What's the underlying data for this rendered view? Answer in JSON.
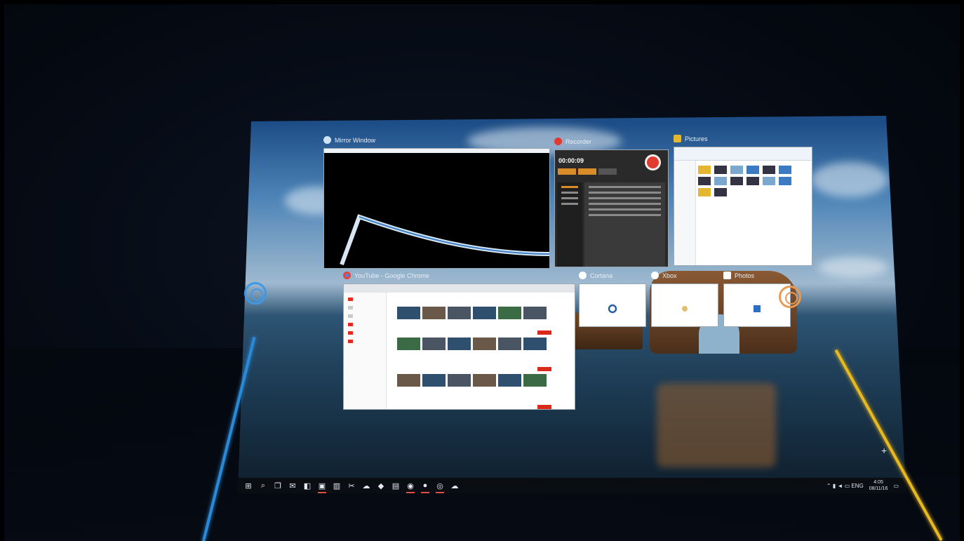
{
  "windows": {
    "vr_view": {
      "title": "Mirror Window",
      "title_color": "#cfe3f5"
    },
    "media_app": {
      "title": "Recorder",
      "time": "00:00:09",
      "accent": "#d98c28",
      "record_color": "#e23a2e"
    },
    "explorer": {
      "title": "Pictures"
    },
    "chrome": {
      "title": "YouTube - Google Chrome"
    },
    "app_a": {
      "title": "Cortana"
    },
    "app_b": {
      "title": "Xbox"
    },
    "app_c": {
      "title": "Photos"
    }
  },
  "handles": {
    "left_color": "#3e9ae6",
    "right_color": "#e89a54"
  },
  "taskbar": {
    "items": [
      {
        "icon": "windows-start-icon",
        "glyph": "⊞",
        "open": false
      },
      {
        "icon": "search-icon",
        "glyph": "⌕",
        "open": false
      },
      {
        "icon": "task-view-icon",
        "glyph": "❐",
        "open": false
      },
      {
        "icon": "mail-icon",
        "glyph": "✉",
        "open": false
      },
      {
        "icon": "store-icon",
        "glyph": "◧",
        "open": false
      },
      {
        "icon": "file-explorer-icon",
        "glyph": "▣",
        "open": true
      },
      {
        "icon": "trash-icon",
        "glyph": "▥",
        "open": false
      },
      {
        "icon": "snip-icon",
        "glyph": "✂",
        "open": false
      },
      {
        "icon": "weather-icon",
        "glyph": "☁",
        "open": false
      },
      {
        "icon": "vr-icon",
        "glyph": "◆",
        "open": false
      },
      {
        "icon": "media-player-icon",
        "glyph": "▤",
        "open": false
      },
      {
        "icon": "steam-icon",
        "glyph": "◉",
        "open": true
      },
      {
        "icon": "recorder-icon",
        "glyph": "●",
        "open": true
      },
      {
        "icon": "chrome-icon",
        "glyph": "◎",
        "open": true
      },
      {
        "icon": "cloud-app-icon",
        "glyph": "☁",
        "open": false
      }
    ],
    "tray_icons": "⌃ ▮ ◄ ▭ ENG",
    "time": "4:05",
    "date": "08/11/16"
  }
}
